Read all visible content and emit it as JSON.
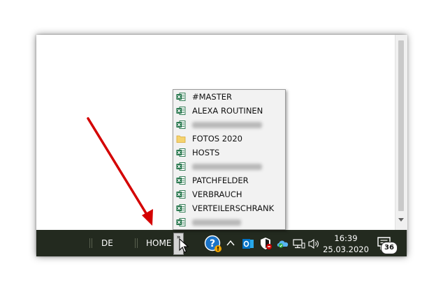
{
  "menu": {
    "items": [
      {
        "label": "#MASTER",
        "icon": "excel-icon",
        "blurred": false
      },
      {
        "label": "ALEXA ROUTINEN",
        "icon": "excel-icon",
        "blurred": false
      },
      {
        "label": "",
        "icon": "excel-icon",
        "blurred": true
      },
      {
        "label": "FOTOS 2020",
        "icon": "folder-icon",
        "blurred": false
      },
      {
        "label": "HOSTS",
        "icon": "excel-icon",
        "blurred": false
      },
      {
        "label": "",
        "icon": "excel-icon",
        "blurred": true
      },
      {
        "label": "PATCHFELDER",
        "icon": "excel-icon",
        "blurred": false
      },
      {
        "label": "VERBRAUCH",
        "icon": "excel-icon",
        "blurred": false
      },
      {
        "label": "VERTEILERSCHRANK",
        "icon": "excel-icon",
        "blurred": false
      },
      {
        "label": "",
        "icon": "excel-icon",
        "blurred": true
      }
    ]
  },
  "taskbar": {
    "toolbar_de": "DE",
    "toolbar_home": "HOME",
    "chevron": "»",
    "clock_time": "16:39",
    "clock_date": "25.03.2020",
    "notification_count": "36"
  },
  "colors": {
    "taskbar_bg": "#232a1f",
    "arrow": "#d40000",
    "excel_green": "#1e7145",
    "folder_yellow": "#f5d36e",
    "outlook_blue": "#0072c6",
    "help_blue": "#1a73c8"
  }
}
